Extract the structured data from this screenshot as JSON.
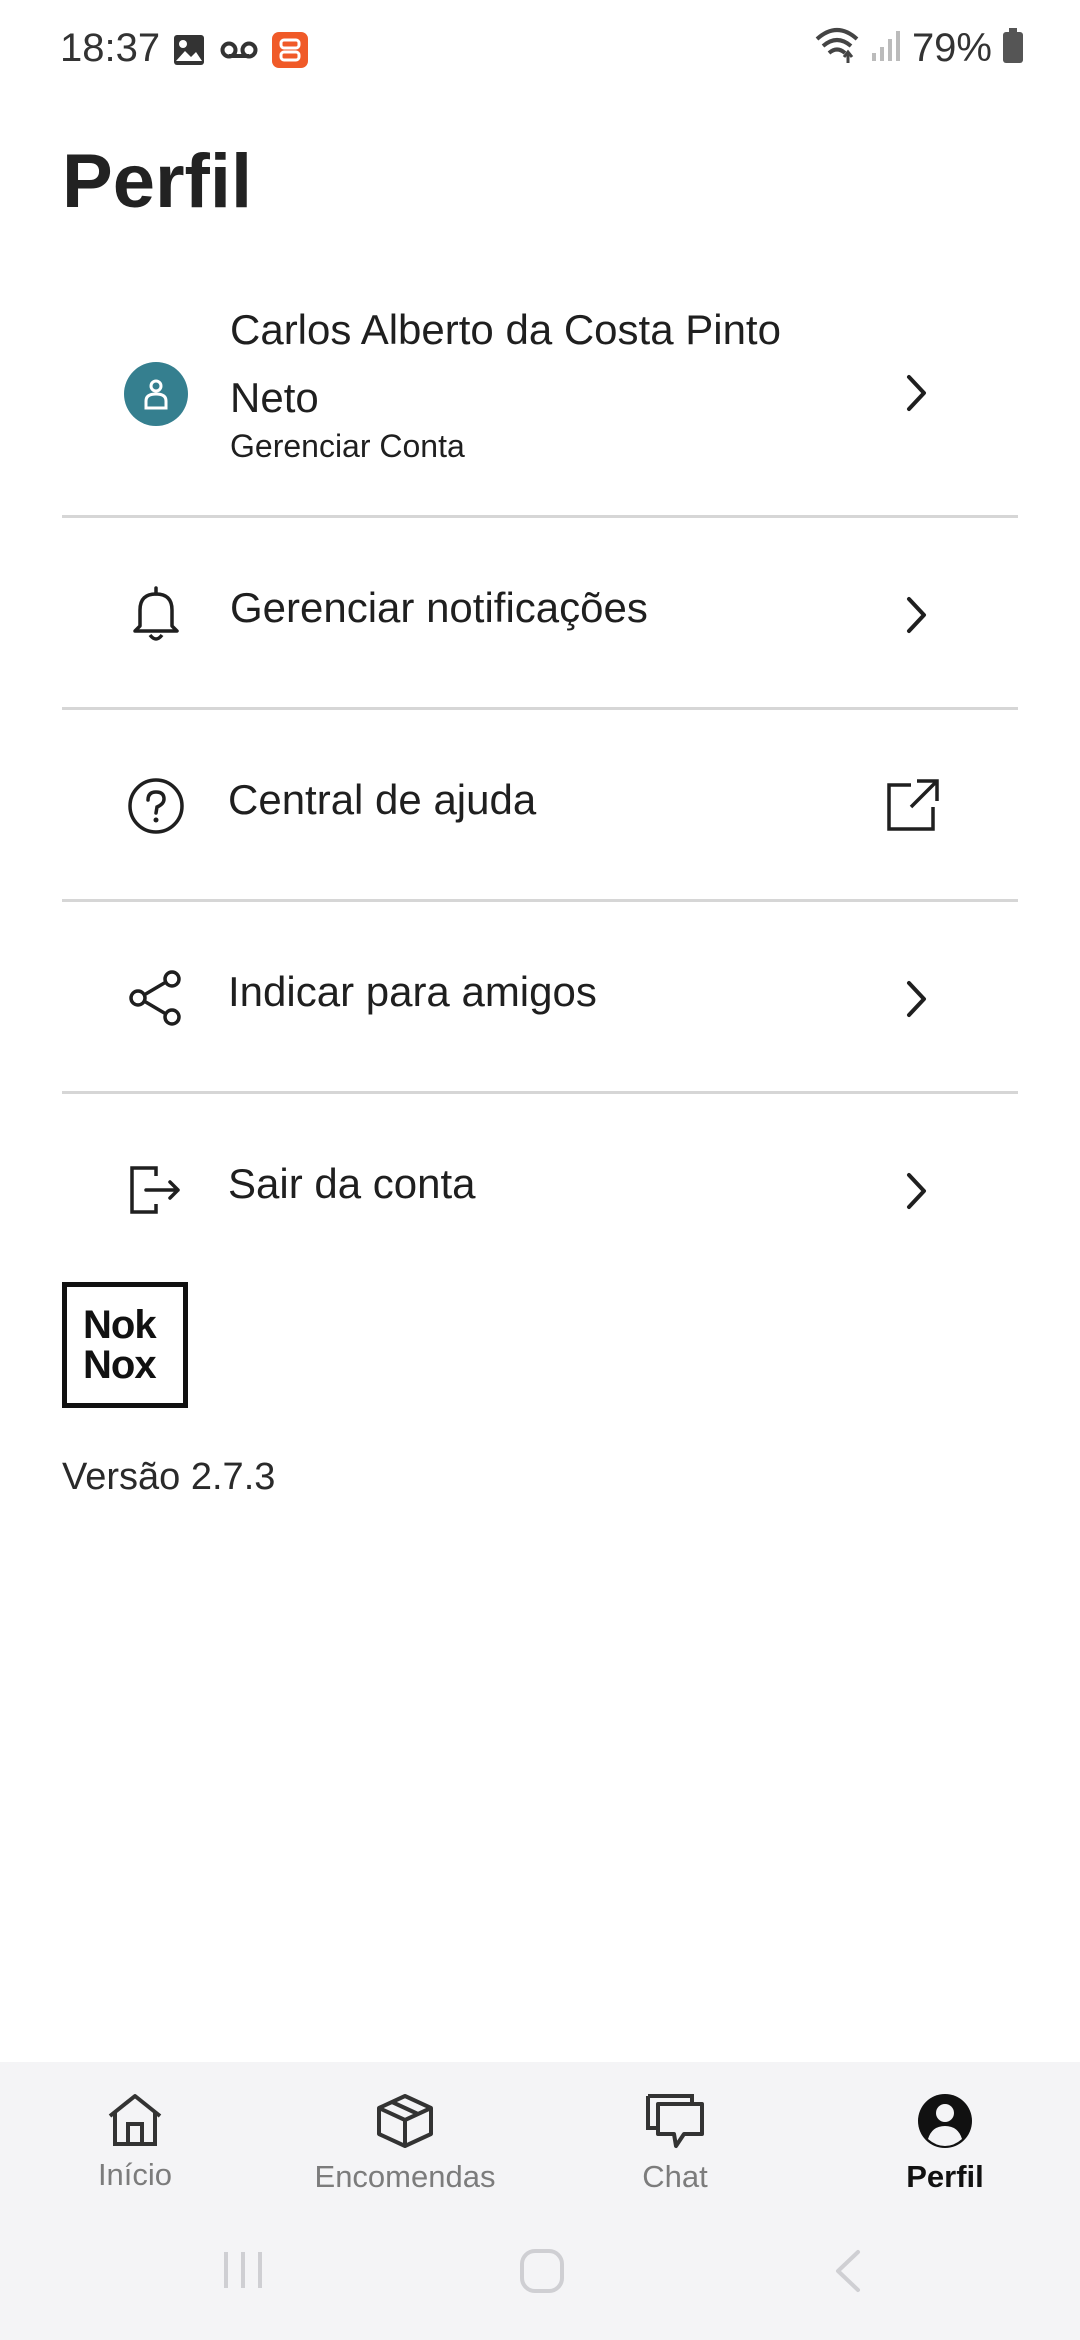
{
  "status_bar": {
    "time": "18:37",
    "battery": "79%",
    "icons_left": [
      "image-icon",
      "voicemail-icon",
      "app-notification-icon"
    ],
    "icons_right": [
      "wifi-icon",
      "signal-icon",
      "battery-icon"
    ]
  },
  "page": {
    "title": "Perfil"
  },
  "profile": {
    "name": "Carlos Alberto da Costa Pinto Neto",
    "subtitle": "Gerenciar Conta",
    "avatar_color": "#357f8f"
  },
  "menu": {
    "notifications": "Gerenciar notificações",
    "help": "Central de ajuda",
    "share": "Indicar para amigos",
    "logout": "Sair da conta"
  },
  "brand": {
    "logo_line1": "Nok",
    "logo_line2": "Nox"
  },
  "version": "Versão 2.7.3",
  "bottom_nav": {
    "tabs": [
      {
        "label": "Início",
        "icon": "home-icon",
        "active": false
      },
      {
        "label": "Encomendas",
        "icon": "package-icon",
        "active": false
      },
      {
        "label": "Chat",
        "icon": "chat-icon",
        "active": false
      },
      {
        "label": "Perfil",
        "icon": "profile-icon",
        "active": true
      }
    ]
  },
  "colors": {
    "accent": "#357f8f",
    "divider": "#d6d6d6",
    "nav_bg": "#f4f4f6"
  }
}
